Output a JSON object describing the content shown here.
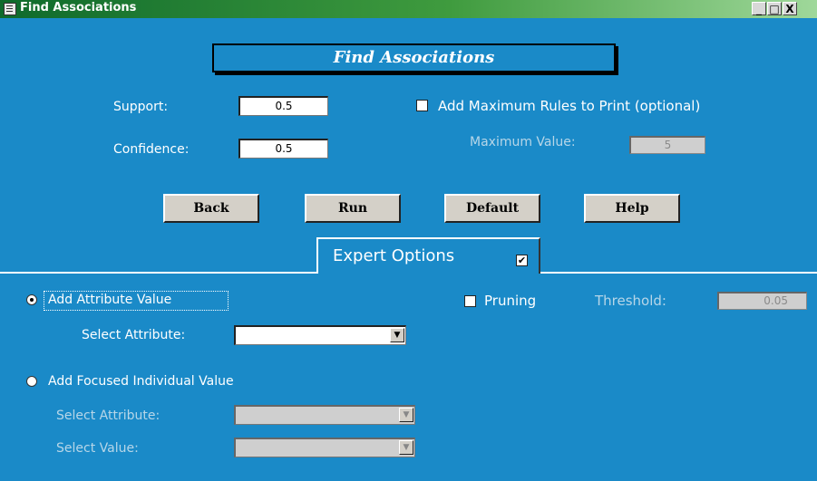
{
  "window": {
    "title": "Find Associations",
    "controls": {
      "minimize": "_",
      "maximize": "□",
      "close": "X"
    }
  },
  "header": {
    "title": "Find Associations"
  },
  "support": {
    "label": "Support:",
    "value": "0.5"
  },
  "confidence": {
    "label": "Confidence:",
    "value": "0.5"
  },
  "max_rules": {
    "checkbox_label": "Add Maximum Rules to Print (optional)",
    "checked": false
  },
  "max_value": {
    "label": "Maximum Value:",
    "value": "5"
  },
  "buttons": {
    "back": "Back",
    "run": "Run",
    "default": "Default",
    "help": "Help"
  },
  "expert_options": {
    "label": "Expert Options",
    "checked": true,
    "check_glyph": "✔"
  },
  "attribute_value": {
    "label": "Add Attribute Value",
    "selected": true,
    "select_label": "Select Attribute:",
    "select_value": ""
  },
  "pruning": {
    "label": "Pruning",
    "checked": false
  },
  "threshold": {
    "label": "Threshold:",
    "value": "0.05"
  },
  "focused": {
    "label": "Add Focused Individual Value",
    "selected": false,
    "attr_label": "Select Attribute:",
    "value_label": "Select Value:"
  },
  "icons": {
    "dropdown_arrow": "▼"
  }
}
